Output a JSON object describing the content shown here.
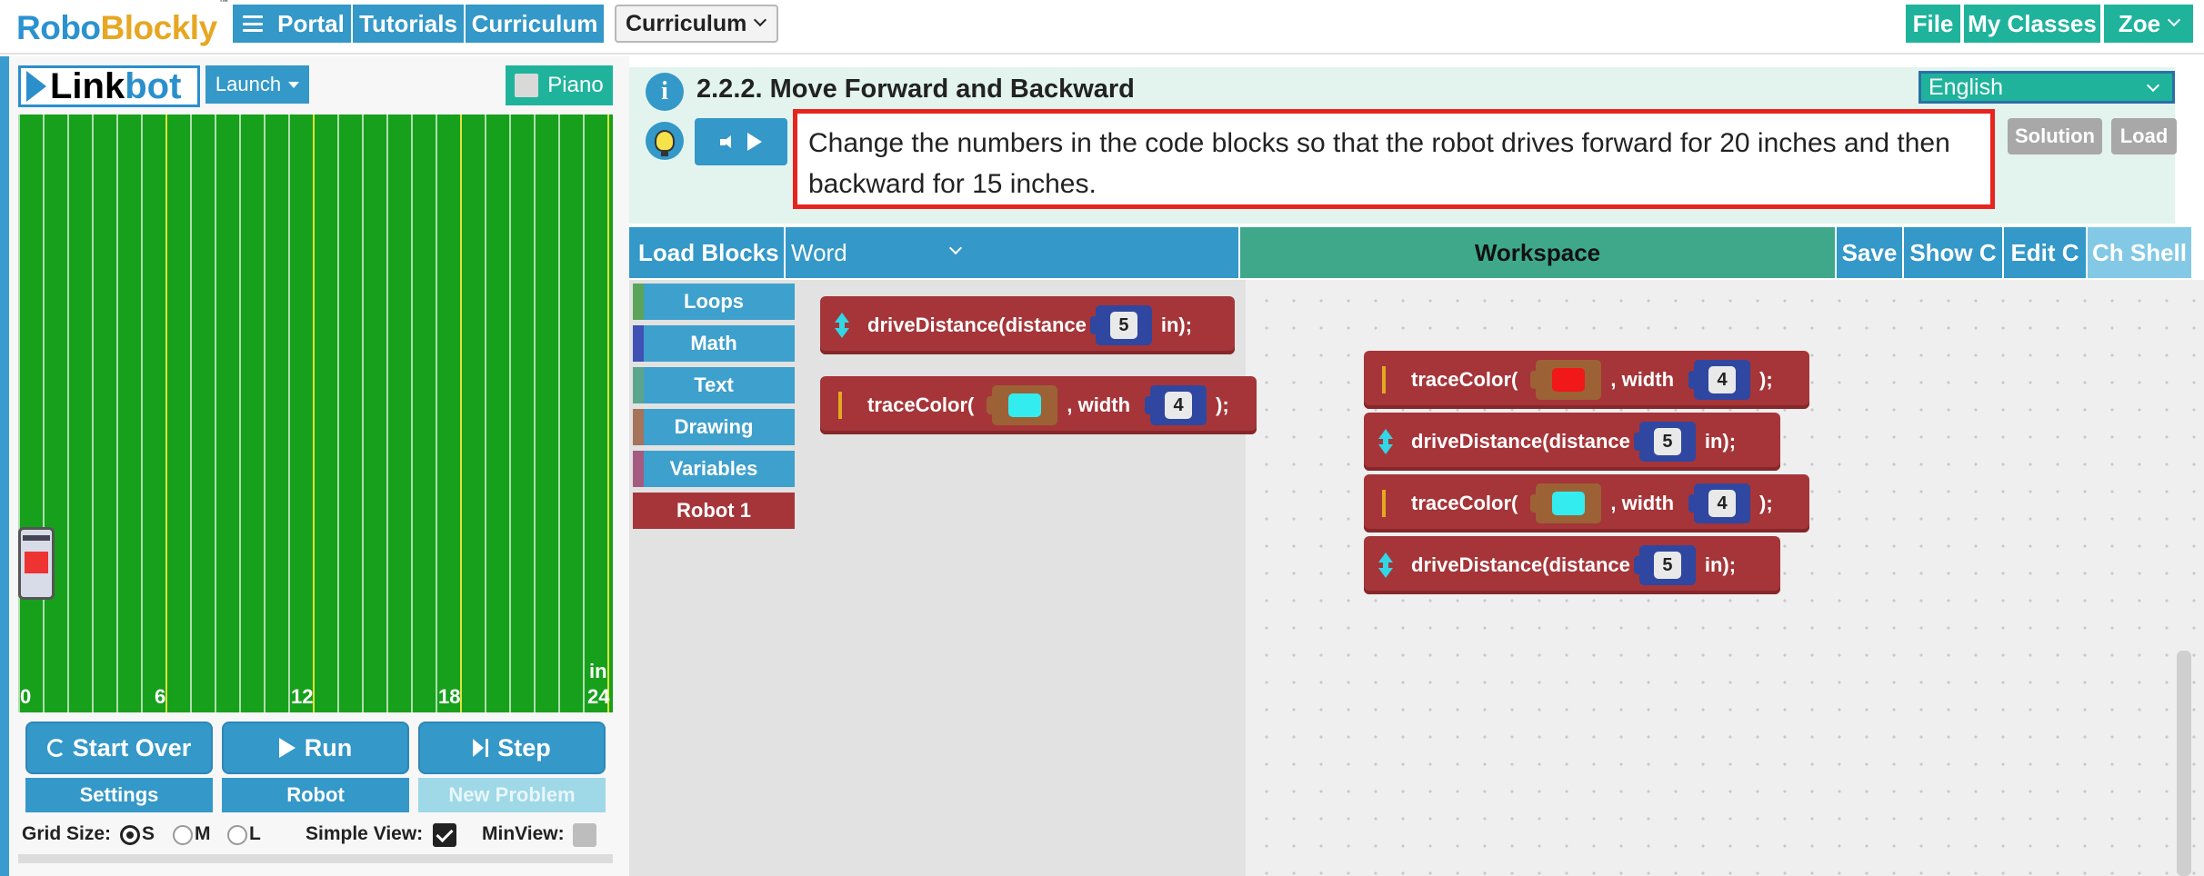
{
  "topbar": {
    "logo_part1": "Robo",
    "logo_part2": "Blockly",
    "logo_tm": "™",
    "portal": "Portal",
    "tutorials": "Tutorials",
    "curriculum": "Curriculum",
    "curriculum_select": "Curriculum",
    "file": "File",
    "my_classes": "My Classes",
    "user": "Zoe"
  },
  "left": {
    "logo_link": "Link",
    "logo_bot": "bot",
    "launch": "Launch",
    "piano": "Piano",
    "ticks": [
      "0",
      "6",
      "12",
      "18",
      "24"
    ],
    "unit": "in",
    "start_over": "Start Over",
    "run": "Run",
    "step": "Step",
    "settings": "Settings",
    "robot": "Robot",
    "new_problem": "New Problem",
    "grid_size_label": "Grid Size:",
    "grid_s": "S",
    "grid_m": "M",
    "grid_l": "L",
    "grid_selected": "S",
    "simple_view_label": "Simple View:",
    "simple_view_checked": true,
    "min_view_label": "MinView:",
    "min_view_checked": false
  },
  "problem": {
    "title": "2.2.2. Move Forward and Backward",
    "language": "English",
    "description": "Change the numbers in the code blocks so that the robot drives forward for 20 inches and then backward for 15 inches.",
    "solution": "Solution",
    "load": "Load"
  },
  "toolbar": {
    "load_blocks": "Load Blocks",
    "word": "Word",
    "workspace": "Workspace",
    "save": "Save",
    "show_c": "Show C",
    "edit_c": "Edit C",
    "ch_shell": "Ch Shell"
  },
  "categories": [
    {
      "label": "Loops",
      "color": "#5ba55b"
    },
    {
      "label": "Math",
      "color": "#3f51b5"
    },
    {
      "label": "Text",
      "color": "#5ba58c"
    },
    {
      "label": "Drawing",
      "color": "#a5745b"
    },
    {
      "label": "Variables",
      "color": "#a55b80"
    },
    {
      "label": "Robot 1",
      "color": "#a53539"
    }
  ],
  "flyout_blocks": {
    "drive": {
      "label": "driveDistance(distance",
      "value": "5",
      "suffix": "in);"
    },
    "trace": {
      "label": "traceColor(",
      "color": "#33ecf0",
      "mid": ", width",
      "width": "4",
      "suffix": ");"
    }
  },
  "workspace_blocks": [
    {
      "type": "trace",
      "label": "traceColor(",
      "color": "#f01818",
      "mid": ", width",
      "width": "4",
      "suffix": ");"
    },
    {
      "type": "drive",
      "label": "driveDistance(distance",
      "value": "5",
      "suffix": "in);"
    },
    {
      "type": "trace",
      "label": "traceColor(",
      "color": "#33ecf0",
      "mid": ", width",
      "width": "4",
      "suffix": ");"
    },
    {
      "type": "drive",
      "label": "driveDistance(distance",
      "value": "5",
      "suffix": "in);"
    }
  ]
}
